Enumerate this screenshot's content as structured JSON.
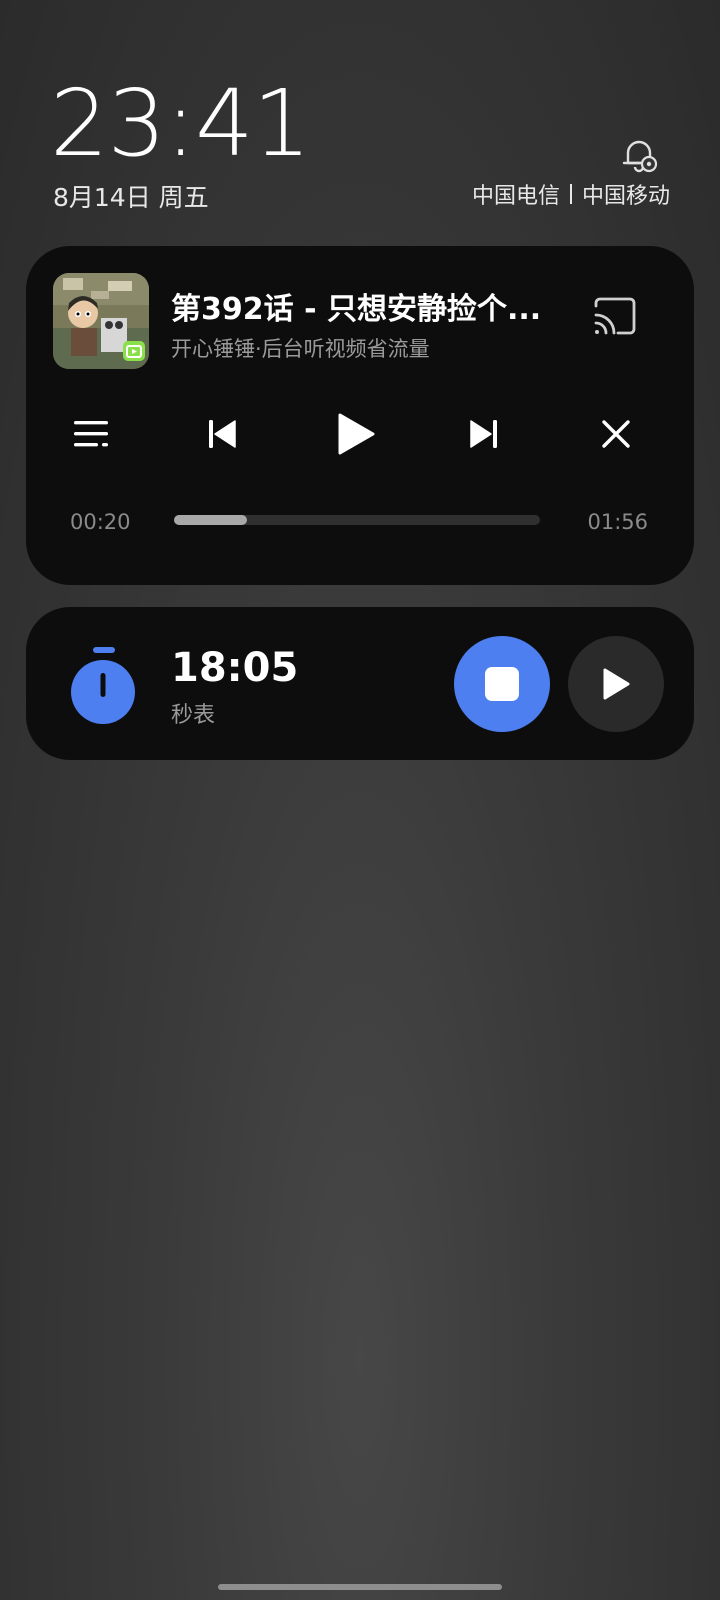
{
  "lockscreen": {
    "time": "23:41",
    "date": "8月14日 周五",
    "carrier_1": "中国电信",
    "carrier_2": "中国移动"
  },
  "media_player": {
    "title": "第392话 - 只想安静捡个...",
    "subtitle": "开心锤锤·后台听视频省流量",
    "current_time": "00:20",
    "total_time": "01:56",
    "progress": 0.2,
    "icons": [
      "album-cover",
      "cast-icon",
      "playlist-icon",
      "previous-icon",
      "play-icon",
      "next-icon",
      "close-icon"
    ]
  },
  "stopwatch": {
    "time": "18:05",
    "label": "秒表",
    "accent_color": "#4d7ff0",
    "icons": [
      "stopwatch-icon",
      "stop-icon",
      "play-icon"
    ]
  }
}
